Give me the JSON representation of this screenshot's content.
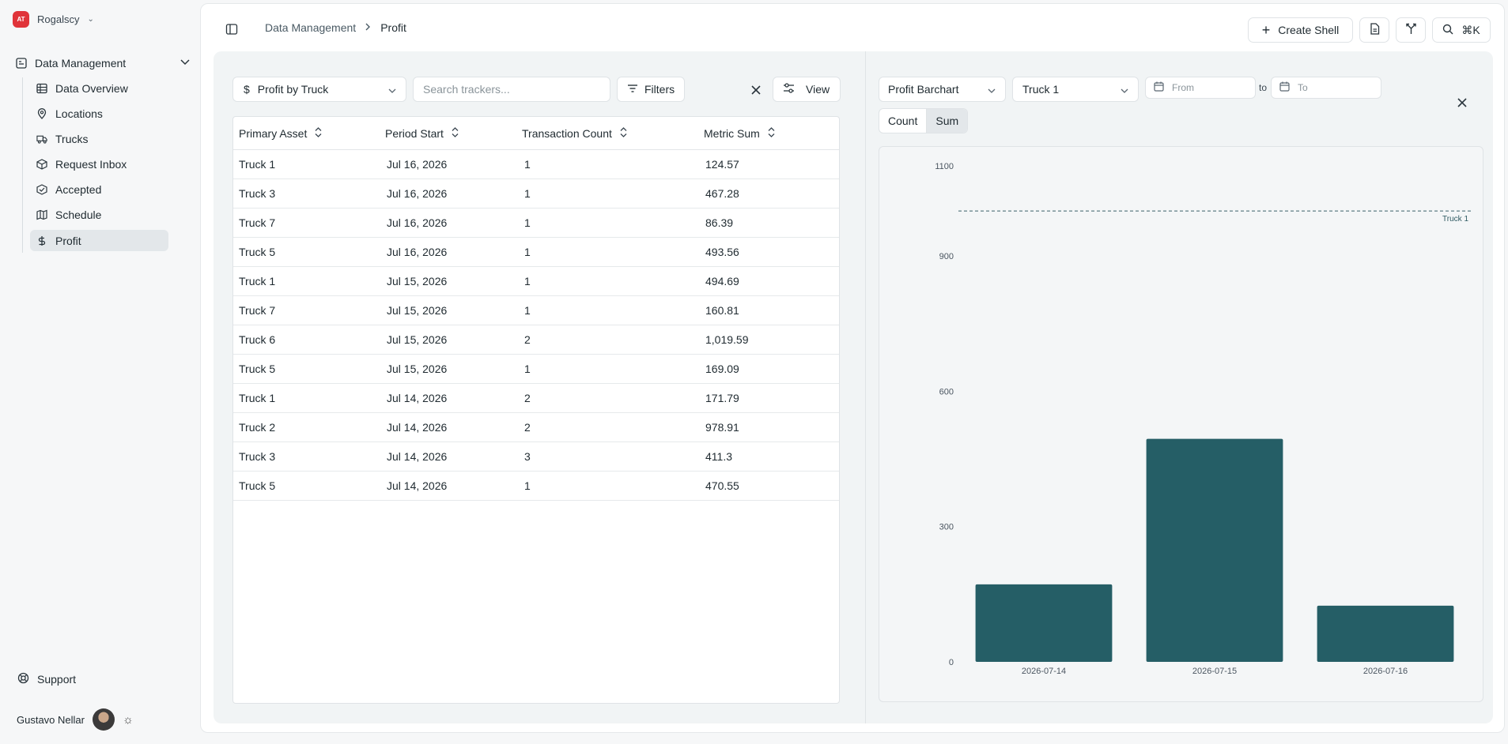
{
  "org": {
    "name": "Rogalscy",
    "logo_text": "AT"
  },
  "sidebar": {
    "group_label": "Data Management",
    "items": [
      {
        "label": "Data Overview",
        "icon": "table-icon"
      },
      {
        "label": "Locations",
        "icon": "map-pin-icon"
      },
      {
        "label": "Trucks",
        "icon": "truck-icon"
      },
      {
        "label": "Request Inbox",
        "icon": "package-icon"
      },
      {
        "label": "Accepted",
        "icon": "box-check-icon"
      },
      {
        "label": "Schedule",
        "icon": "map-icon"
      },
      {
        "label": "Profit",
        "icon": "dollar-icon"
      }
    ],
    "active": "Profit",
    "support_label": "Support",
    "user_name": "Gustavo Nellar"
  },
  "breadcrumb": {
    "parent": "Data Management",
    "current": "Profit"
  },
  "toolbar": {
    "create_label": "Create Shell",
    "shortcut": "⌘K"
  },
  "left_panel": {
    "tracker_select": "Profit by Truck",
    "search_placeholder": "Search trackers...",
    "filters_label": "Filters",
    "view_label": "View",
    "columns": [
      "Primary Asset",
      "Period Start",
      "Transaction Count",
      "Metric Sum"
    ],
    "rows": [
      [
        "Truck 1",
        "Jul 16, 2026",
        "1",
        "124.57"
      ],
      [
        "Truck 3",
        "Jul 16, 2026",
        "1",
        "467.28"
      ],
      [
        "Truck 7",
        "Jul 16, 2026",
        "1",
        "86.39"
      ],
      [
        "Truck 5",
        "Jul 16, 2026",
        "1",
        "493.56"
      ],
      [
        "Truck 1",
        "Jul 15, 2026",
        "1",
        "494.69"
      ],
      [
        "Truck 7",
        "Jul 15, 2026",
        "1",
        "160.81"
      ],
      [
        "Truck 6",
        "Jul 15, 2026",
        "2",
        "1,019.59"
      ],
      [
        "Truck 5",
        "Jul 15, 2026",
        "1",
        "169.09"
      ],
      [
        "Truck 1",
        "Jul 14, 2026",
        "2",
        "171.79"
      ],
      [
        "Truck 2",
        "Jul 14, 2026",
        "2",
        "978.91"
      ],
      [
        "Truck 3",
        "Jul 14, 2026",
        "3",
        "411.3"
      ],
      [
        "Truck 5",
        "Jul 14, 2026",
        "1",
        "470.55"
      ]
    ]
  },
  "right_panel": {
    "chart_select": "Profit Barchart",
    "truck_select": "Truck 1",
    "from_placeholder": "From",
    "to_word": "to",
    "to_placeholder": "To",
    "seg_count": "Count",
    "seg_sum": "Sum",
    "active_segment": "Sum"
  },
  "chart_data": {
    "type": "bar",
    "categories": [
      "2026-07-14",
      "2026-07-15",
      "2026-07-16"
    ],
    "values": [
      171.79,
      494.69,
      124.57
    ],
    "yticks": [
      0,
      300,
      600,
      900,
      1100
    ],
    "ylim": [
      0,
      1100
    ],
    "reference_line": {
      "label": "Truck 1",
      "value": 1000,
      "style": "dashed"
    },
    "bar_color": "#255e66",
    "title": "",
    "xlabel": "",
    "ylabel": ""
  },
  "colors": {
    "accent": "#255e66",
    "brand": "#e0343a"
  }
}
